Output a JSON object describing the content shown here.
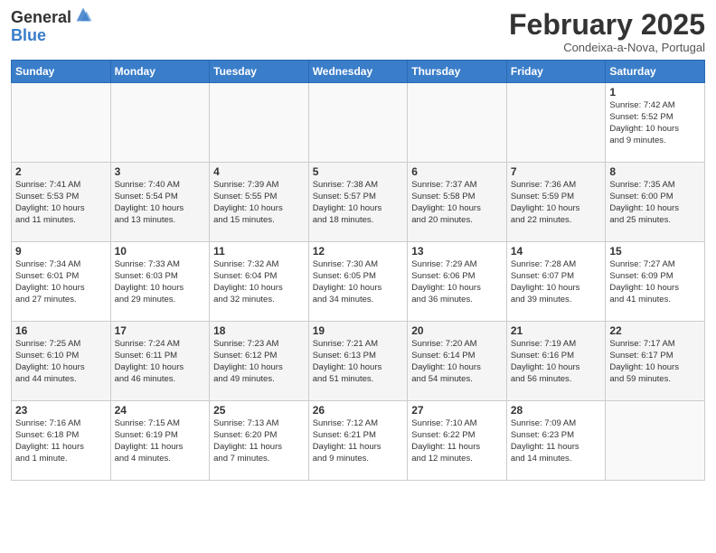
{
  "logo": {
    "general": "General",
    "blue": "Blue"
  },
  "title": "February 2025",
  "subtitle": "Condeixa-a-Nova, Portugal",
  "weekdays": [
    "Sunday",
    "Monday",
    "Tuesday",
    "Wednesday",
    "Thursday",
    "Friday",
    "Saturday"
  ],
  "weeks": [
    [
      {
        "day": "",
        "info": ""
      },
      {
        "day": "",
        "info": ""
      },
      {
        "day": "",
        "info": ""
      },
      {
        "day": "",
        "info": ""
      },
      {
        "day": "",
        "info": ""
      },
      {
        "day": "",
        "info": ""
      },
      {
        "day": "1",
        "info": "Sunrise: 7:42 AM\nSunset: 5:52 PM\nDaylight: 10 hours\nand 9 minutes."
      }
    ],
    [
      {
        "day": "2",
        "info": "Sunrise: 7:41 AM\nSunset: 5:53 PM\nDaylight: 10 hours\nand 11 minutes."
      },
      {
        "day": "3",
        "info": "Sunrise: 7:40 AM\nSunset: 5:54 PM\nDaylight: 10 hours\nand 13 minutes."
      },
      {
        "day": "4",
        "info": "Sunrise: 7:39 AM\nSunset: 5:55 PM\nDaylight: 10 hours\nand 15 minutes."
      },
      {
        "day": "5",
        "info": "Sunrise: 7:38 AM\nSunset: 5:57 PM\nDaylight: 10 hours\nand 18 minutes."
      },
      {
        "day": "6",
        "info": "Sunrise: 7:37 AM\nSunset: 5:58 PM\nDaylight: 10 hours\nand 20 minutes."
      },
      {
        "day": "7",
        "info": "Sunrise: 7:36 AM\nSunset: 5:59 PM\nDaylight: 10 hours\nand 22 minutes."
      },
      {
        "day": "8",
        "info": "Sunrise: 7:35 AM\nSunset: 6:00 PM\nDaylight: 10 hours\nand 25 minutes."
      }
    ],
    [
      {
        "day": "9",
        "info": "Sunrise: 7:34 AM\nSunset: 6:01 PM\nDaylight: 10 hours\nand 27 minutes."
      },
      {
        "day": "10",
        "info": "Sunrise: 7:33 AM\nSunset: 6:03 PM\nDaylight: 10 hours\nand 29 minutes."
      },
      {
        "day": "11",
        "info": "Sunrise: 7:32 AM\nSunset: 6:04 PM\nDaylight: 10 hours\nand 32 minutes."
      },
      {
        "day": "12",
        "info": "Sunrise: 7:30 AM\nSunset: 6:05 PM\nDaylight: 10 hours\nand 34 minutes."
      },
      {
        "day": "13",
        "info": "Sunrise: 7:29 AM\nSunset: 6:06 PM\nDaylight: 10 hours\nand 36 minutes."
      },
      {
        "day": "14",
        "info": "Sunrise: 7:28 AM\nSunset: 6:07 PM\nDaylight: 10 hours\nand 39 minutes."
      },
      {
        "day": "15",
        "info": "Sunrise: 7:27 AM\nSunset: 6:09 PM\nDaylight: 10 hours\nand 41 minutes."
      }
    ],
    [
      {
        "day": "16",
        "info": "Sunrise: 7:25 AM\nSunset: 6:10 PM\nDaylight: 10 hours\nand 44 minutes."
      },
      {
        "day": "17",
        "info": "Sunrise: 7:24 AM\nSunset: 6:11 PM\nDaylight: 10 hours\nand 46 minutes."
      },
      {
        "day": "18",
        "info": "Sunrise: 7:23 AM\nSunset: 6:12 PM\nDaylight: 10 hours\nand 49 minutes."
      },
      {
        "day": "19",
        "info": "Sunrise: 7:21 AM\nSunset: 6:13 PM\nDaylight: 10 hours\nand 51 minutes."
      },
      {
        "day": "20",
        "info": "Sunrise: 7:20 AM\nSunset: 6:14 PM\nDaylight: 10 hours\nand 54 minutes."
      },
      {
        "day": "21",
        "info": "Sunrise: 7:19 AM\nSunset: 6:16 PM\nDaylight: 10 hours\nand 56 minutes."
      },
      {
        "day": "22",
        "info": "Sunrise: 7:17 AM\nSunset: 6:17 PM\nDaylight: 10 hours\nand 59 minutes."
      }
    ],
    [
      {
        "day": "23",
        "info": "Sunrise: 7:16 AM\nSunset: 6:18 PM\nDaylight: 11 hours\nand 1 minute."
      },
      {
        "day": "24",
        "info": "Sunrise: 7:15 AM\nSunset: 6:19 PM\nDaylight: 11 hours\nand 4 minutes."
      },
      {
        "day": "25",
        "info": "Sunrise: 7:13 AM\nSunset: 6:20 PM\nDaylight: 11 hours\nand 7 minutes."
      },
      {
        "day": "26",
        "info": "Sunrise: 7:12 AM\nSunset: 6:21 PM\nDaylight: 11 hours\nand 9 minutes."
      },
      {
        "day": "27",
        "info": "Sunrise: 7:10 AM\nSunset: 6:22 PM\nDaylight: 11 hours\nand 12 minutes."
      },
      {
        "day": "28",
        "info": "Sunrise: 7:09 AM\nSunset: 6:23 PM\nDaylight: 11 hours\nand 14 minutes."
      },
      {
        "day": "",
        "info": ""
      }
    ]
  ]
}
